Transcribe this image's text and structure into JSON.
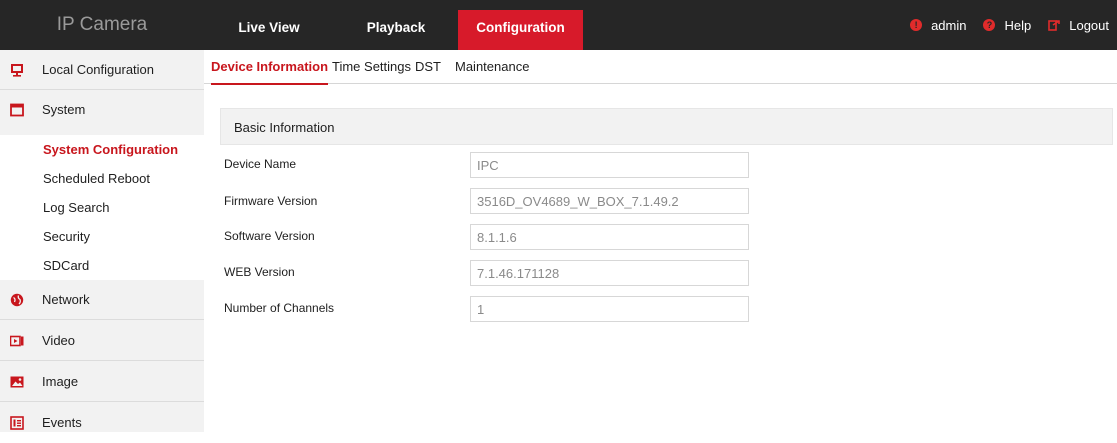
{
  "header": {
    "brand": "IP Camera",
    "nav": {
      "live_view": "Live View",
      "playback": "Playback",
      "configuration": "Configuration"
    },
    "user": {
      "admin": "admin",
      "help": "Help",
      "logout": "Logout"
    }
  },
  "sidebar": {
    "local_configuration": "Local Configuration",
    "system": "System",
    "system_submenu": [
      "System Configuration",
      "Scheduled Reboot",
      "Log Search",
      "Security",
      "SDCard"
    ],
    "network": "Network",
    "video": "Video",
    "image": "Image",
    "events": "Events"
  },
  "tabs": {
    "device_information": "Device Information",
    "time_settings": "Time Settings",
    "dst": "DST",
    "maintenance": "Maintenance"
  },
  "panel": {
    "title": "Basic Information"
  },
  "fields": [
    {
      "label": "Device Name",
      "value": "IPC"
    },
    {
      "label": "Firmware Version",
      "value": "3516D_OV4689_W_BOX_7.1.49.2"
    },
    {
      "label": "Software Version",
      "value": "8.1.1.6"
    },
    {
      "label": "WEB Version",
      "value": "7.1.46.171128"
    },
    {
      "label": "Number of Channels",
      "value": "1"
    }
  ],
  "colors": {
    "accent": "#c8161d",
    "topbar": "#262626",
    "sidebar": "#f2f2f2"
  }
}
